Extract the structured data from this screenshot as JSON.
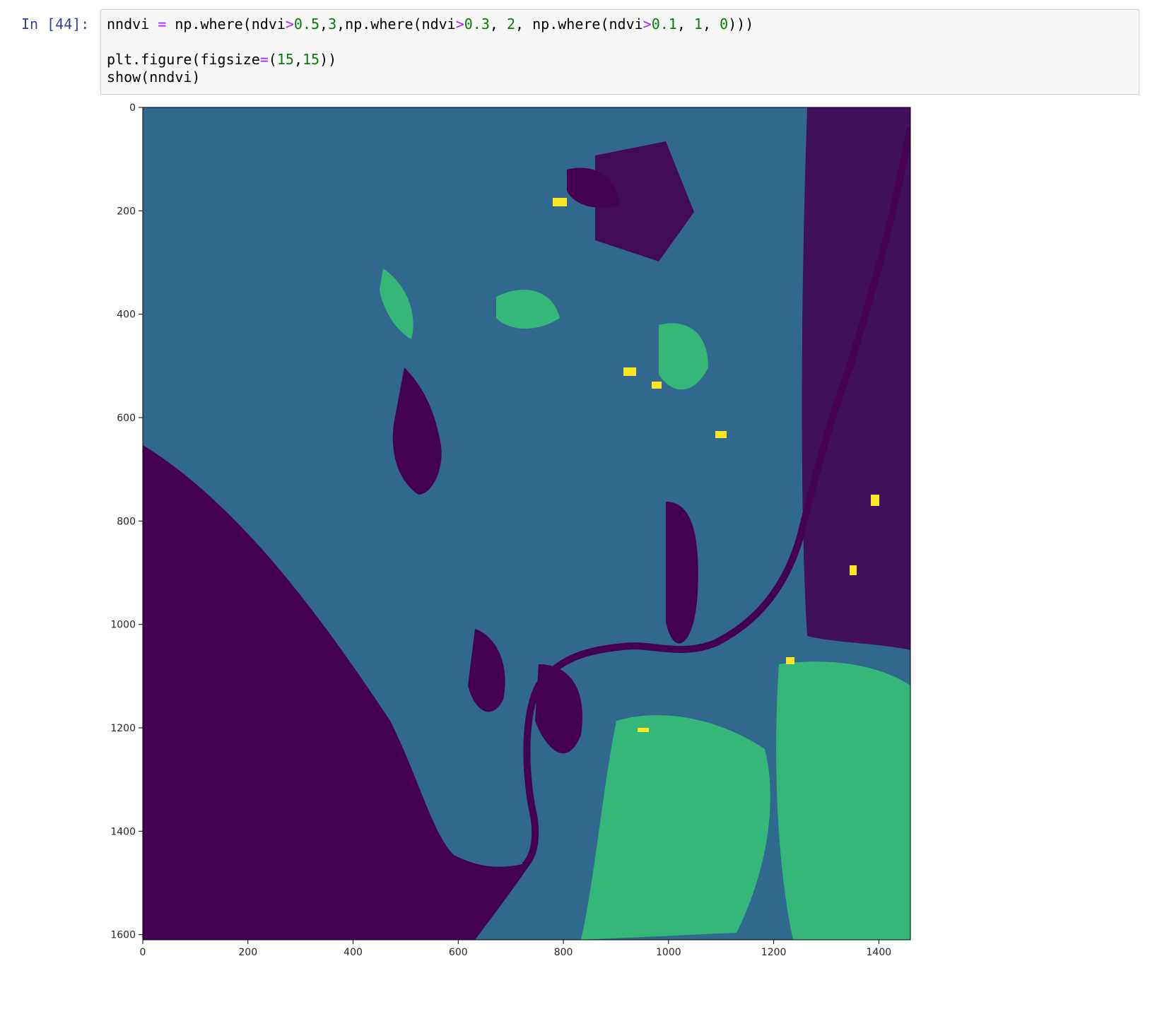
{
  "cell": {
    "prompt": "In [44]:",
    "code": {
      "line1": {
        "a": "nndvi ",
        "op1": "=",
        "b": " np.where(ndvi",
        "gt1": ">",
        "n1": "0.5",
        "c": ",",
        "n2": "3",
        "d": ",np.where(ndvi",
        "gt2": ">",
        "n3": "0.3",
        "e": ", ",
        "n4": "2",
        "f": ", np.where(ndvi",
        "gt3": ">",
        "n5": "0.1",
        "g": ", ",
        "n6": "1",
        "h": ", ",
        "n7": "0",
        "i": ")))"
      },
      "line3": {
        "a": "plt.figure(figsize",
        "op": "=",
        "b": "(",
        "n1": "15",
        "c": ",",
        "n2": "15",
        "d": "))"
      },
      "line4": "show(nndvi)"
    }
  },
  "colors": {
    "class0": "#440154",
    "class1": "#31688e",
    "class2": "#35b779",
    "class3": "#fde725"
  },
  "chart_data": {
    "type": "heatmap",
    "title": "",
    "xlabel": "",
    "ylabel": "",
    "colormap": "viridis",
    "classes": [
      0,
      1,
      2,
      3
    ],
    "xlim": [
      0,
      1460
    ],
    "ylim": [
      1610,
      0
    ],
    "x_ticks": [
      "0",
      "200",
      "400",
      "600",
      "800",
      "1000",
      "1200",
      "1400"
    ],
    "y_ticks": [
      "0",
      "200",
      "400",
      "600",
      "800",
      "1000",
      "1200",
      "1400",
      "1600"
    ],
    "grid": false
  }
}
